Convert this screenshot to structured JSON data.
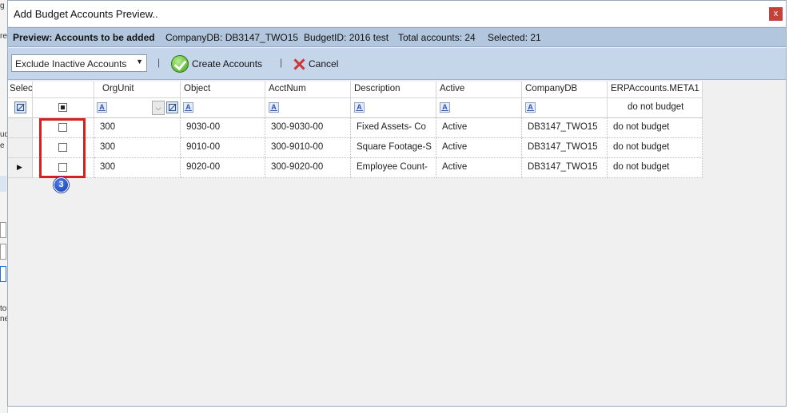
{
  "background_app": {
    "fragments": [
      "g",
      "re",
      "ud",
      "e",
      "to",
      "ne"
    ]
  },
  "window": {
    "title": "Add Budget Accounts Preview..",
    "close_label": "x"
  },
  "info_bar": {
    "heading": "Preview: Accounts to be added",
    "company_db": "CompanyDB: DB3147_TWO15",
    "budget_id": "BudgetID: 2016 test",
    "total_accounts": "Total accounts: 24",
    "selected": "Selected: 21"
  },
  "toolbar": {
    "filter_select": {
      "value": "Exclude Inactive Accounts",
      "icon": "chevron-down-icon"
    },
    "separator": "|",
    "create_label": "Create Accounts",
    "create_icon": "green-check-icon",
    "cancel_label": "Cancel",
    "cancel_icon": "red-x-icon"
  },
  "grid": {
    "columns": [
      "Select",
      "OrgUnit",
      "Object",
      "AcctNum",
      "Description",
      "Active",
      "CompanyDB",
      "ERPAccounts.META1"
    ],
    "filter_row": {
      "filter_glyph": "A",
      "meta1_filter_value": "do not budget"
    },
    "rows": [
      {
        "orgunit": "300",
        "object": "9030-00",
        "acctnum": "300-9030-00",
        "description": "Fixed Assets- Co",
        "active": "Active",
        "companydb": "DB3147_TWO15",
        "meta1": "do not budget",
        "current": false
      },
      {
        "orgunit": "300",
        "object": "9010-00",
        "acctnum": "300-9010-00",
        "description": "Square Footage-S",
        "active": "Active",
        "companydb": "DB3147_TWO15",
        "meta1": "do not budget",
        "current": false
      },
      {
        "orgunit": "300",
        "object": "9020-00",
        "acctnum": "300-9020-00",
        "description": "Employee Count-",
        "active": "Active",
        "companydb": "DB3147_TWO15",
        "meta1": "do not budget",
        "current": true
      }
    ]
  },
  "callout": {
    "number": "3",
    "color": "#d42020"
  },
  "colors": {
    "info_bar": "#b2c6de",
    "toolbar": "#c5d6ea",
    "highlight": "#d42020",
    "badge": "#1f4fc8"
  }
}
